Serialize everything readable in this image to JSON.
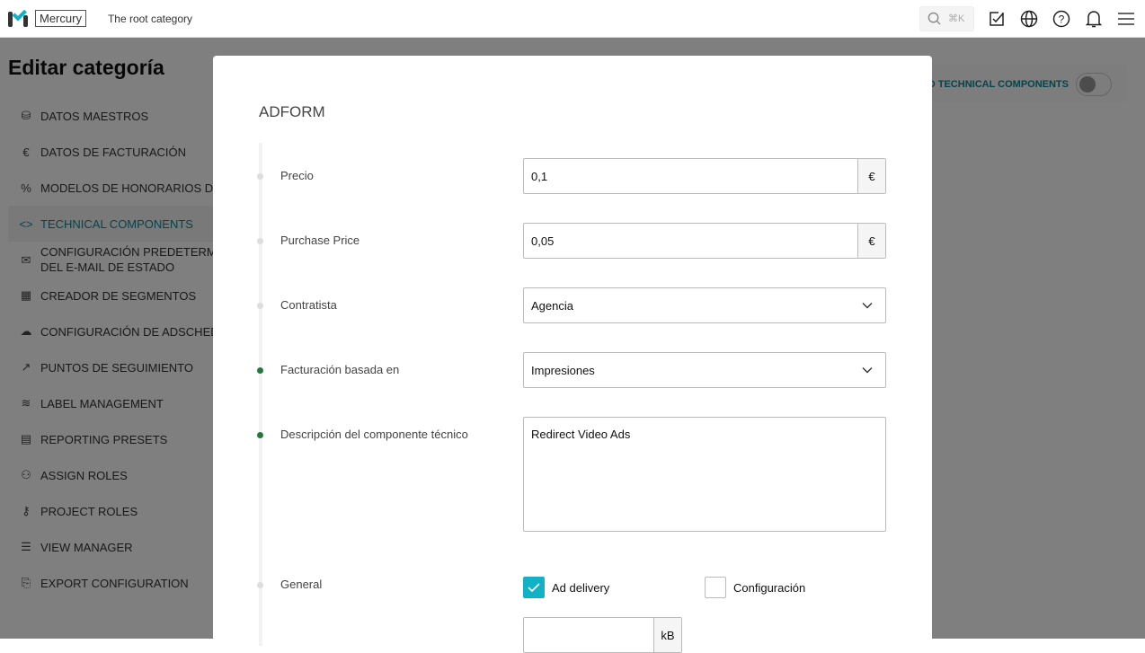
{
  "topbar": {
    "brand": "Mercury",
    "breadcrumb": "The root category",
    "search_shortcut": "⌘K"
  },
  "sidebar": {
    "title": "Editar categoría",
    "items": [
      {
        "label": "Datos maestros",
        "icon": "database-icon",
        "glyph": "⛁"
      },
      {
        "label": "Datos de facturación",
        "icon": "euro-icon",
        "glyph": "€"
      },
      {
        "label": "Modelos de honorarios de ag",
        "icon": "percent-icon",
        "glyph": "%"
      },
      {
        "label": "Technical components",
        "icon": "code-icon",
        "glyph": "<>"
      },
      {
        "label": "Configuración predeterminad",
        "label2": "del e-mail de estado",
        "icon": "mail-icon",
        "glyph": "✉"
      },
      {
        "label": "Creador de segmentos",
        "icon": "grid-icon",
        "glyph": "▦"
      },
      {
        "label": "Configuración de adscheduli",
        "icon": "cloud-icon",
        "glyph": "☁"
      },
      {
        "label": "Puntos de seguimiento",
        "icon": "trend-icon",
        "glyph": "↗"
      },
      {
        "label": "Label management",
        "icon": "layers-icon",
        "glyph": "≋"
      },
      {
        "label": "Reporting presets",
        "icon": "document-icon",
        "glyph": "▤"
      },
      {
        "label": "Assign roles",
        "icon": "users-icon",
        "glyph": "⚇"
      },
      {
        "label": "Project roles",
        "icon": "key-icon",
        "glyph": "⚷"
      },
      {
        "label": "View manager",
        "icon": "list-icon",
        "glyph": "☰"
      },
      {
        "label": "Export configuration",
        "icon": "file-export-icon",
        "glyph": "⎘"
      }
    ]
  },
  "toggle": {
    "label": "TED TECHNICAL COMPONENTS",
    "on": false
  },
  "modal": {
    "title": "ADFORM",
    "precio": {
      "label": "Precio",
      "value": "0,1",
      "unit": "€"
    },
    "purchase": {
      "label": "Purchase Price",
      "value": "0,05",
      "unit": "€"
    },
    "contratista": {
      "label": "Contratista",
      "value": "Agencia"
    },
    "facturacion": {
      "label": "Facturación basada en",
      "value": "Impresiones"
    },
    "descripcion": {
      "label": "Descripción del componente técnico",
      "value": "Redirect Video Ads"
    },
    "general": {
      "label": "General",
      "ad_delivery": "Ad delivery",
      "ad_delivery_checked": true,
      "configuracion": "Configuración",
      "configuracion_checked": false,
      "size_unit": "kB",
      "size_value": ""
    }
  }
}
